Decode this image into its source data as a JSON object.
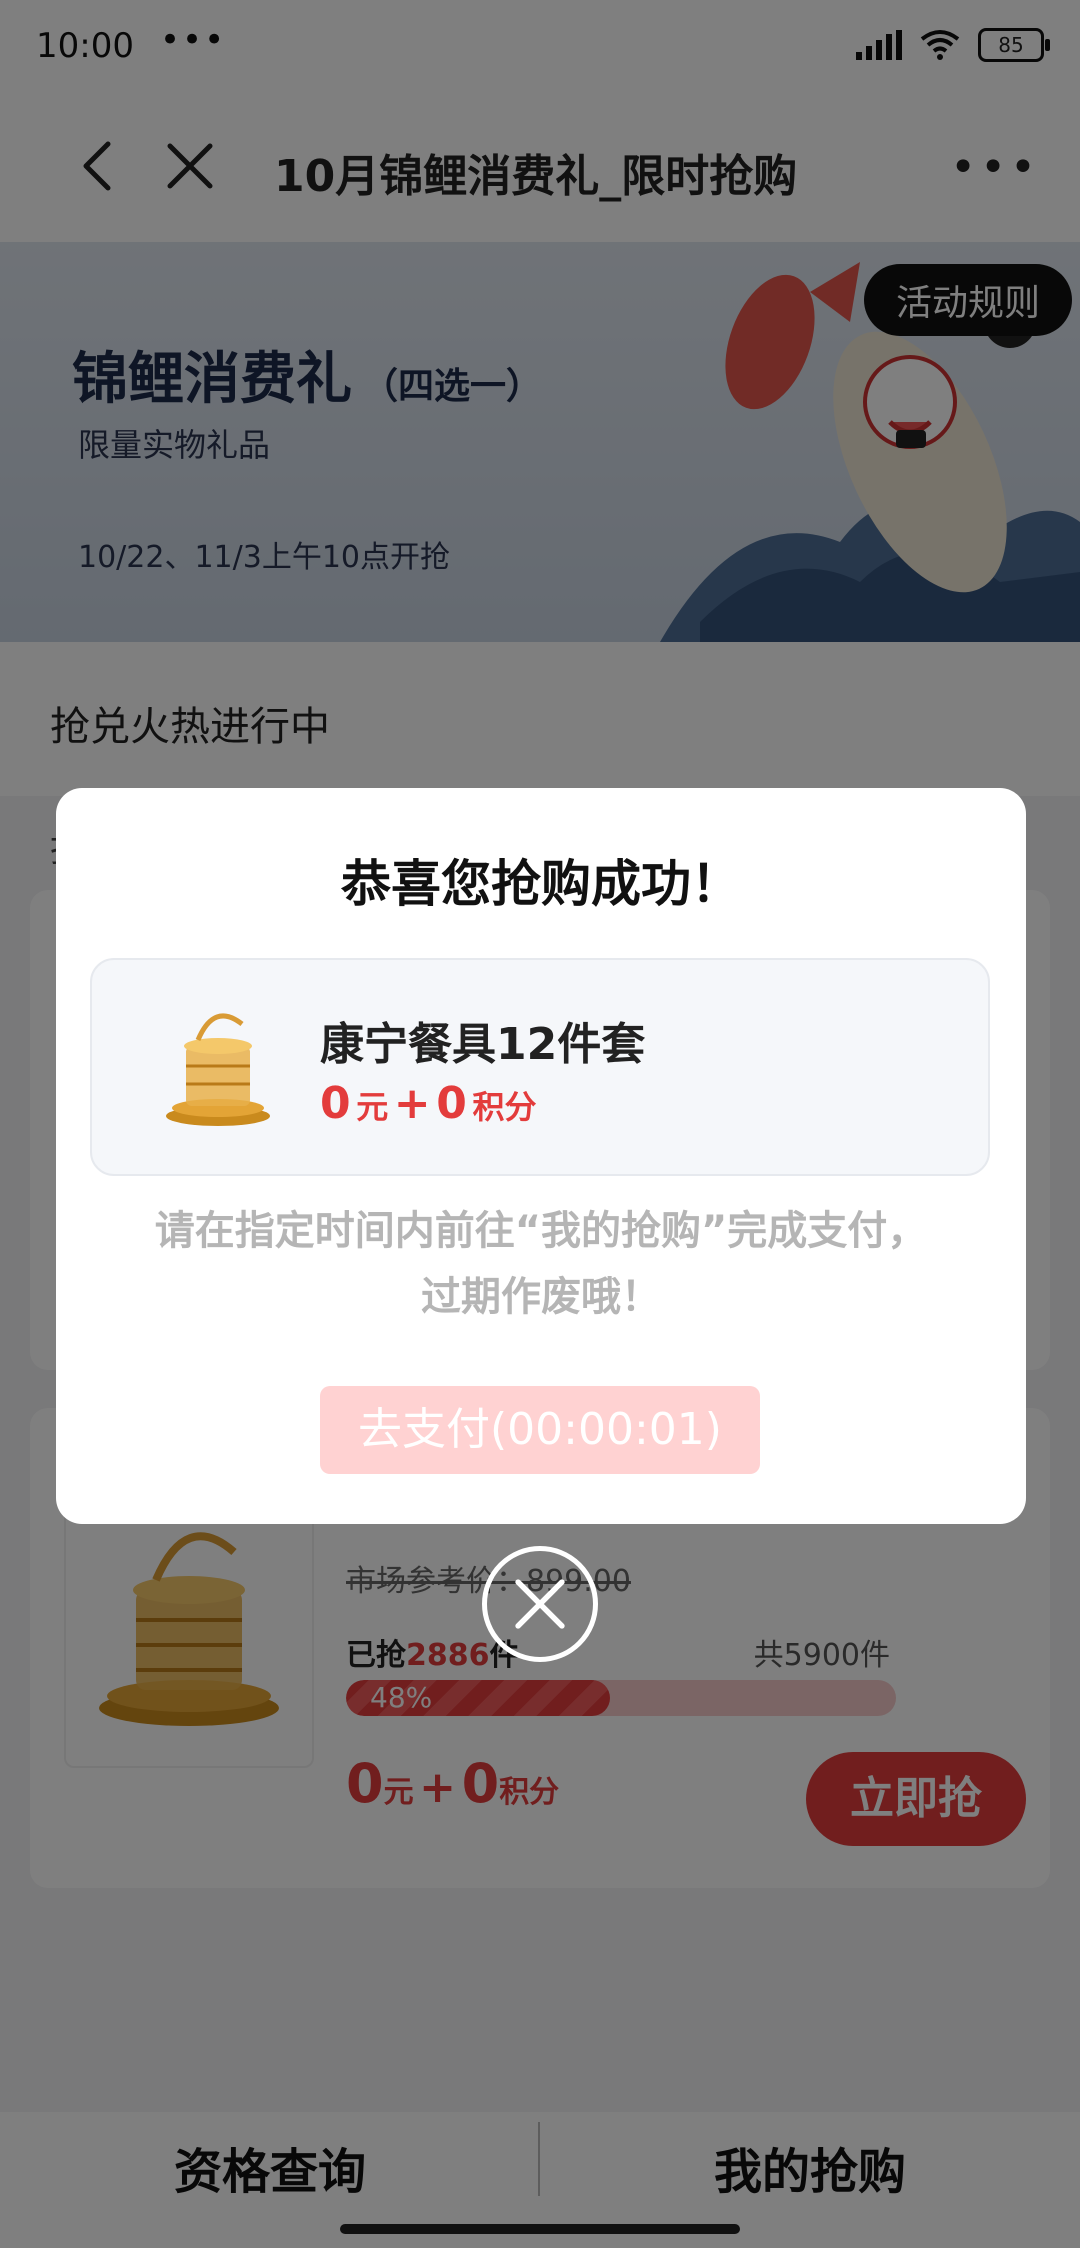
{
  "status_bar": {
    "time": "10:00",
    "dots": "•••",
    "battery": "85"
  },
  "nav": {
    "title": "10月锦鲤消费礼_限时抢购",
    "more": "•••"
  },
  "banner": {
    "title": "锦鲤消费礼",
    "title_suffix": "（四选一）",
    "subtitle": "限量实物礼品",
    "date": "10/22、11/3上午10点开抢",
    "rules_button": "活动规则"
  },
  "section": {
    "heading": "抢兑火热进行中",
    "label": "抢"
  },
  "product_card": {
    "market_price": "市场参考价：899.00",
    "grabbed_prefix": "已抢",
    "grabbed_count": "2886",
    "grabbed_suffix": "件",
    "total": "共5900件",
    "progress_label": "48%",
    "progress": 0.48,
    "price_yuan": "0",
    "unit_yuan": "元",
    "plus": "+",
    "price_points": "0",
    "unit_points": "积分",
    "buy_button": "立即抢"
  },
  "modal": {
    "title": "恭喜您抢购成功！",
    "item_name": "康宁餐具12件套",
    "price_yuan": "0",
    "unit_yuan": "元",
    "plus": "+",
    "price_points": "0",
    "unit_points": "积分",
    "note_line1": "请在指定时间内前往“我的抢购”完成支付，",
    "note_line2": "过期作废哦！",
    "pay_button": "去支付(00:00:01)"
  },
  "bottom_tabs": {
    "left": "资格查询",
    "right": "我的抢购"
  },
  "colors": {
    "accent": "#e33c3c",
    "pay_button": "#ffd2d2",
    "mask": "rgba(0,0,0,0.5)"
  }
}
